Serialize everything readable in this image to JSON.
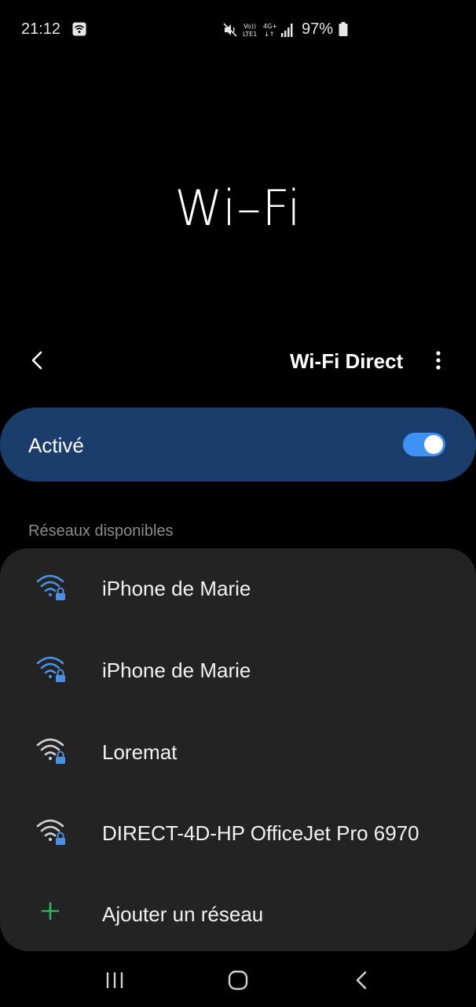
{
  "status_bar": {
    "time": "21:12",
    "battery": "97%",
    "icons": [
      "wifi-notification-icon",
      "mute-icon",
      "volte-icon",
      "4g-plus-icon",
      "signal-icon",
      "battery-icon"
    ]
  },
  "header": {
    "title": "Wi–Fi",
    "wifi_direct_label": "Wi-Fi Direct"
  },
  "toggle_card": {
    "label": "Activé",
    "enabled": true
  },
  "networks_section": {
    "title": "Réseaux disponibles",
    "networks": [
      {
        "name": "iPhone de Marie",
        "secured": true,
        "signal_color": "#4a90e2"
      },
      {
        "name": "iPhone de Marie",
        "secured": true,
        "signal_color": "#4a90e2"
      },
      {
        "name": "Loremat",
        "secured": true,
        "signal_color": "#d0d0d0"
      },
      {
        "name": "DIRECT-4D-HP OfficeJet Pro 6970",
        "secured": true,
        "signal_color": "#d0d0d0"
      }
    ],
    "add_network_label": "Ajouter un réseau"
  },
  "colors": {
    "accent": "#3e91f5",
    "card_active": "#1a3d6b",
    "list_bg": "#232323",
    "add_icon": "#2fb35a"
  }
}
